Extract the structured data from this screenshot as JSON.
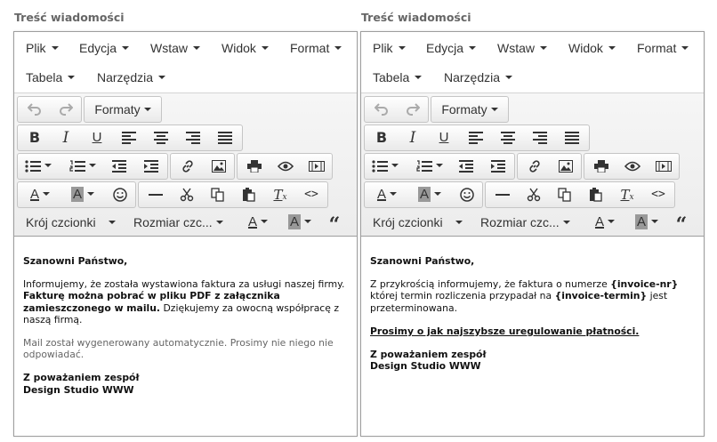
{
  "panels": [
    {
      "label": "Treść wiadomości",
      "menus": {
        "file": "Plik",
        "edit": "Edycja",
        "insert": "Wstaw",
        "view": "Widok",
        "format": "Format",
        "table": "Tabela",
        "tools": "Narzędzia"
      },
      "toolbar": {
        "formats": "Formaty",
        "font_family": "Krój czcionki",
        "font_size": "Rozmiar czc..."
      },
      "content": {
        "greeting": "Szanowni Państwo,",
        "p1_a": "Informujemy, że została wystawiona faktura za usługi naszej firmy. ",
        "p1_b": "Fakturę można pobrać w pliku PDF z załącznika zamieszczonego w mailu.",
        "p1_c": " Dziękujemy za owocną współpracę z naszą firmą.",
        "note": "Mail został wygenerowany automatycznie. Prosimy nie niego nie odpowiadać.",
        "sign1": "Z poważaniem zespół",
        "sign2": "Design Studio WWW"
      }
    },
    {
      "label": "Treść wiadomości",
      "menus": {
        "file": "Plik",
        "edit": "Edycja",
        "insert": "Wstaw",
        "view": "Widok",
        "format": "Format",
        "table": "Tabela",
        "tools": "Narzędzia"
      },
      "toolbar": {
        "formats": "Formaty",
        "font_family": "Krój czcionki",
        "font_size": "Rozmiar czc..."
      },
      "content": {
        "greeting": "Szanowni Państwo,",
        "p1_a": "Z przykrością informujemy, że faktura o numerze ",
        "p1_b": "{invoice-nr}",
        "p1_c": " której termin rozliczenia przypadał na ",
        "p1_d": "{invoice-termin}",
        "p1_e": " jest przeterminowana.",
        "request": "Prosimy o jak najszybsze uregulowanie płatności.",
        "sign1": "Z poważaniem zespół",
        "sign2": "Design Studio WWW"
      }
    }
  ]
}
